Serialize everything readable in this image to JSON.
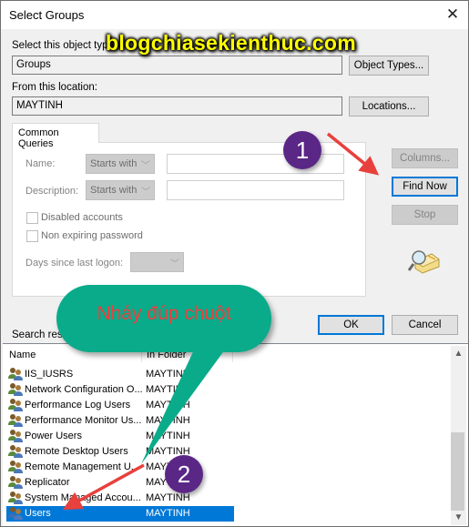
{
  "window": {
    "title": "Select Groups",
    "close_icon": "close-icon"
  },
  "object_type": {
    "label": "Select this object type:",
    "value": "Groups",
    "button": "Object Types..."
  },
  "location": {
    "label": "From this location:",
    "value": "MAYTINH",
    "button": "Locations..."
  },
  "common_queries": {
    "tab_label": "Common Queries",
    "name_label": "Name:",
    "name_mode": "Starts with",
    "name_value": "",
    "description_label": "Description:",
    "description_mode": "Starts with",
    "description_value": "",
    "disabled_accounts_label": "Disabled accounts",
    "disabled_accounts_checked": false,
    "non_expiring_label": "Non expiring password",
    "non_expiring_checked": false,
    "days_label": "Days since last logon:",
    "days_value": ""
  },
  "side_buttons": {
    "columns": "Columns...",
    "find_now": "Find Now",
    "stop": "Stop"
  },
  "actions": {
    "ok": "OK",
    "cancel": "Cancel"
  },
  "results": {
    "label": "Search results:",
    "columns": [
      "Name",
      "In Folder"
    ],
    "rows": [
      {
        "name": "IIS_IUSRS",
        "folder": "MAYTINH",
        "selected": false
      },
      {
        "name": "Network Configuration O...",
        "folder": "MAYTINH",
        "selected": false
      },
      {
        "name": "Performance Log Users",
        "folder": "MAYTINH",
        "selected": false
      },
      {
        "name": "Performance Monitor Us...",
        "folder": "MAYTINH",
        "selected": false
      },
      {
        "name": "Power Users",
        "folder": "MAYTINH",
        "selected": false
      },
      {
        "name": "Remote Desktop Users",
        "folder": "MAYTINH",
        "selected": false
      },
      {
        "name": "Remote Management U...",
        "folder": "MAYTINH",
        "selected": false
      },
      {
        "name": "Replicator",
        "folder": "MAYTINH",
        "selected": false
      },
      {
        "name": "System Managed Accou...",
        "folder": "MAYTINH",
        "selected": false
      },
      {
        "name": "Users",
        "folder": "MAYTINH",
        "selected": true
      }
    ]
  },
  "annotations": {
    "watermark": "blogchiasekienthuc.com",
    "step1": "1",
    "step2": "2",
    "callout": "Nháy đúp chuột",
    "colors": {
      "badge": "#5b2786",
      "arrow": "#e8403c",
      "callout": "#0aab8a",
      "callout_text": "#ef3e3e",
      "watermark": "#ffff00",
      "selection": "#0078d7"
    }
  }
}
